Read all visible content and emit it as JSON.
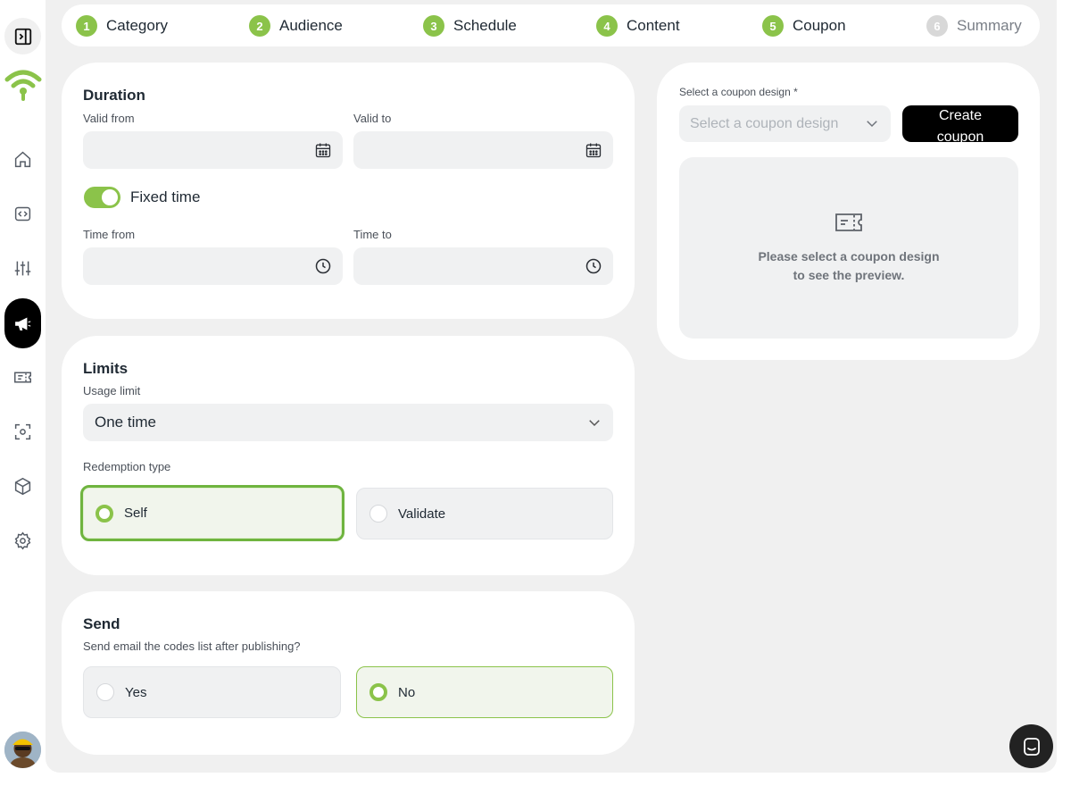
{
  "steps": [
    {
      "num": "1",
      "label": "Category",
      "state": "done"
    },
    {
      "num": "2",
      "label": "Audience",
      "state": "done"
    },
    {
      "num": "3",
      "label": "Schedule",
      "state": "done"
    },
    {
      "num": "4",
      "label": "Content",
      "state": "done"
    },
    {
      "num": "5",
      "label": "Coupon",
      "state": "done"
    },
    {
      "num": "6",
      "label": "Summary",
      "state": "pending"
    }
  ],
  "duration": {
    "title": "Duration",
    "valid_from_label": "Valid from",
    "valid_to_label": "Valid to",
    "valid_from_value": "",
    "valid_to_value": "",
    "fixed_time_label": "Fixed time",
    "fixed_time_on": true,
    "time_from_label": "Time from",
    "time_to_label": "Time to",
    "time_from_value": "",
    "time_to_value": ""
  },
  "limits": {
    "title": "Limits",
    "usage_limit_label": "Usage limit",
    "usage_limit_value": "One time",
    "redemption_type_label": "Redemption type",
    "options": [
      {
        "label": "Self",
        "selected": true
      },
      {
        "label": "Validate",
        "selected": false
      }
    ]
  },
  "send": {
    "title": "Send",
    "question": "Send email the codes list after publishing?",
    "options": [
      {
        "label": "Yes",
        "selected": false
      },
      {
        "label": "No",
        "selected": true
      }
    ]
  },
  "coupon": {
    "design_label": "Select a coupon design *",
    "design_placeholder": "Select a coupon design",
    "create_button": "Create coupon",
    "preview_line1": "Please select a coupon design",
    "preview_line2": "to see the preview."
  },
  "colors": {
    "accent": "#8bc34a",
    "background": "#f0f0f0",
    "card": "#ffffff",
    "dark": "#000000"
  },
  "icons": {
    "sidebar": [
      "collapse-panel-icon",
      "wifi-logo-icon",
      "home-icon",
      "code-icon",
      "sliders-icon",
      "megaphone-icon",
      "ticket-icon",
      "scan-icon",
      "box-icon",
      "settings-icon"
    ],
    "chat": "chat-icon"
  }
}
